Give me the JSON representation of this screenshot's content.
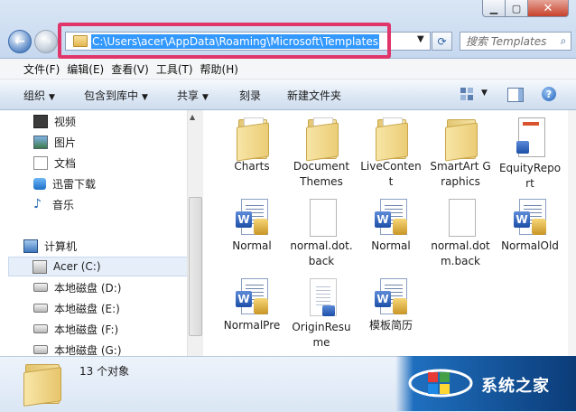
{
  "address": {
    "path": "C:\\Users\\acer\\AppData\\Roaming\\Microsoft\\Templates",
    "search_placeholder": "搜索 Templates"
  },
  "menubar": [
    "文件(F)",
    "编辑(E)",
    "查看(V)",
    "工具(T)",
    "帮助(H)"
  ],
  "commandbar": {
    "organize": "组织",
    "include_in_library": "包含到库中",
    "share": "共享",
    "burn": "刻录",
    "new_folder": "新建文件夹"
  },
  "sidebar": {
    "libraries": [
      {
        "label": "视频",
        "icon": "video-icon"
      },
      {
        "label": "图片",
        "icon": "picture-icon"
      },
      {
        "label": "文档",
        "icon": "document-icon"
      },
      {
        "label": "迅雷下载",
        "icon": "thunder-download-icon"
      },
      {
        "label": "音乐",
        "icon": "music-icon"
      }
    ],
    "computer": {
      "label": "计算机",
      "icon": "computer-icon"
    },
    "drives": [
      {
        "label": "Acer (C:)",
        "icon": "system-drive-icon",
        "selected": true
      },
      {
        "label": "本地磁盘 (D:)",
        "icon": "drive-icon"
      },
      {
        "label": "本地磁盘 (E:)",
        "icon": "drive-icon"
      },
      {
        "label": "本地磁盘 (F:)",
        "icon": "drive-icon"
      },
      {
        "label": "本地磁盘 (G:)",
        "icon": "drive-icon"
      }
    ]
  },
  "files": [
    {
      "name": "Charts",
      "type": "folder"
    },
    {
      "name": "Document Themes",
      "type": "folder"
    },
    {
      "name": "LiveContent",
      "type": "folder"
    },
    {
      "name": "SmartArt Graphics",
      "type": "folder"
    },
    {
      "name": "EquityReport",
      "type": "report-template"
    },
    {
      "name": "Normal",
      "type": "word-template"
    },
    {
      "name": "normal.dot.back",
      "type": "blank-file"
    },
    {
      "name": "Normal",
      "type": "word-template"
    },
    {
      "name": "normal.dotm.back",
      "type": "blank-file"
    },
    {
      "name": "NormalOld",
      "type": "word-template"
    },
    {
      "name": "NormalPre",
      "type": "word-template"
    },
    {
      "name": "OriginResume",
      "type": "resume-template"
    },
    {
      "name": "模板简历",
      "type": "word-template"
    }
  ],
  "details": {
    "count": "13 个对象"
  },
  "watermark": {
    "text": "系统之家"
  },
  "colors": {
    "address_highlight": "#e0356a",
    "selection": "#3399ff",
    "close_button": "#c7412a",
    "watermark_bg": "#0b3c78"
  }
}
